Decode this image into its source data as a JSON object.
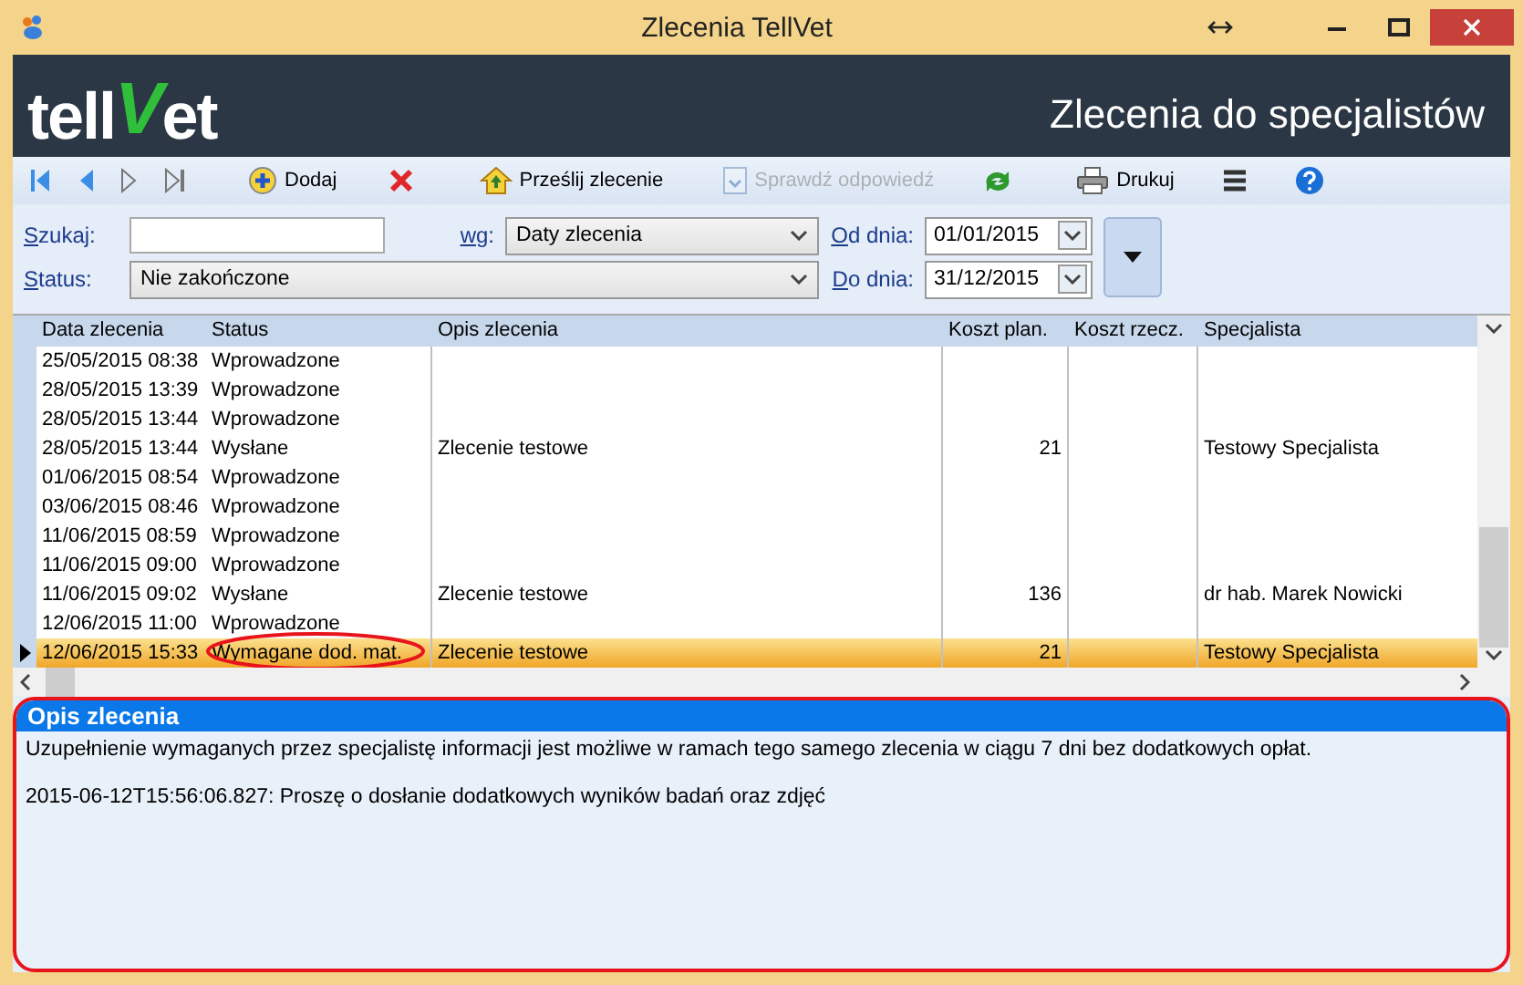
{
  "window": {
    "title": "Zlecenia TellVet"
  },
  "header": {
    "logo_parts": [
      "tell",
      "V",
      "et"
    ],
    "title": "Zlecenia do specjalistów"
  },
  "toolbar": [
    {
      "kind": "first",
      "disabled": false
    },
    {
      "kind": "prev",
      "disabled": false
    },
    {
      "kind": "next",
      "disabled": false
    },
    {
      "kind": "last",
      "disabled": false
    },
    {
      "kind": "add",
      "label": "Dodaj",
      "disabled": false
    },
    {
      "kind": "delete",
      "disabled": false
    },
    {
      "kind": "send",
      "label": "Prześlij zlecenie",
      "disabled": false
    },
    {
      "kind": "check",
      "label": "Sprawdź odpowiedź",
      "disabled": true
    },
    {
      "kind": "refresh",
      "disabled": false
    },
    {
      "kind": "print",
      "label": "Drukuj",
      "disabled": false
    },
    {
      "kind": "menu",
      "disabled": false
    },
    {
      "kind": "help",
      "disabled": false
    }
  ],
  "filters": {
    "search": {
      "label": "Szukaj:"
    },
    "by": {
      "label": "wg:",
      "value": "Daty zlecenia"
    },
    "status": {
      "label": "Status:",
      "value": "Nie zakończone"
    },
    "from": {
      "label": "Od dnia:",
      "value": "01/01/2015"
    },
    "to": {
      "label": "Do dnia:",
      "value": "31/12/2015"
    }
  },
  "table": {
    "columns": [
      "Data zlecenia",
      "Status",
      "Opis zlecenia",
      "Koszt plan.",
      "Koszt rzecz.",
      "Specjalista"
    ],
    "rows": [
      {
        "date": "25/05/2015 08:38",
        "status": "Wprowadzone",
        "selected": false
      },
      {
        "date": "28/05/2015 13:39",
        "status": "Wprowadzone",
        "selected": false
      },
      {
        "date": "28/05/2015 13:44",
        "status": "Wprowadzone",
        "selected": false
      },
      {
        "date": "28/05/2015 13:44",
        "status": "Wysłane",
        "description": "Zlecenie testowe",
        "cost_planned": "21",
        "specialist": "Testowy Specjalista",
        "selected": false
      },
      {
        "date": "01/06/2015 08:54",
        "status": "Wprowadzone",
        "selected": false
      },
      {
        "date": "03/06/2015 08:46",
        "status": "Wprowadzone",
        "selected": false
      },
      {
        "date": "11/06/2015 08:59",
        "status": "Wprowadzone",
        "selected": false
      },
      {
        "date": "11/06/2015 09:00",
        "status": "Wprowadzone",
        "selected": false
      },
      {
        "date": "11/06/2015 09:02",
        "status": "Wysłane",
        "description": "Zlecenie testowe",
        "cost_planned": "136",
        "specialist": "dr hab. Marek Nowicki",
        "selected": false
      },
      {
        "date": "12/06/2015 11:00",
        "status": "Wprowadzone",
        "selected": false
      },
      {
        "date": "12/06/2015 15:33",
        "status": "Wymagane dod. mat.",
        "description": "Zlecenie testowe",
        "cost_planned": "21",
        "specialist": "Testowy Specjalista",
        "selected": true,
        "circled": true
      }
    ]
  },
  "details": {
    "title": "Opis zlecenia",
    "paragraphs": [
      "Uzupełnienie wymaganych przez specjalistę informacji jest możliwe w ramach tego samego zlecenia w ciągu 7 dni bez dodatkowych opłat.",
      "2015-06-12T15:56:06.827: Proszę o dosłanie dodatkowych wyników badań oraz zdjęć"
    ]
  }
}
